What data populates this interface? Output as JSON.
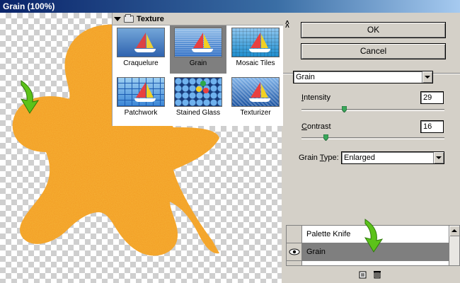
{
  "window": {
    "title": "Grain (100%)"
  },
  "gallery": {
    "folder_label": "Texture",
    "filters": [
      {
        "label": "Craquelure",
        "style": "crack",
        "selected": false
      },
      {
        "label": "Grain",
        "style": "grain",
        "selected": true
      },
      {
        "label": "Mosaic Tiles",
        "style": "mosaic",
        "selected": false
      },
      {
        "label": "Patchwork",
        "style": "patch",
        "selected": false
      },
      {
        "label": "Stained Glass",
        "style": "glass",
        "selected": false
      },
      {
        "label": "Texturizer",
        "style": "textur",
        "selected": false
      }
    ]
  },
  "buttons": {
    "ok": "OK",
    "cancel": "Cancel"
  },
  "filter_select": {
    "value": "Grain"
  },
  "settings": {
    "intensity": {
      "label_mnemonic": "I",
      "label_rest": "ntensity",
      "value": "29",
      "slider_fraction": 0.29
    },
    "contrast": {
      "label_mnemonic": "C",
      "label_rest": "ontrast",
      "value": "16",
      "slider_fraction": 0.16
    },
    "grain_type": {
      "label_before": "Grain ",
      "label_mnemonic": "T",
      "label_rest": "ype:",
      "value": "Enlarged"
    }
  },
  "layers": [
    {
      "name": "Palette Knife",
      "visible": false,
      "active": false
    },
    {
      "name": "Grain",
      "visible": true,
      "active": true
    }
  ],
  "colors": {
    "shape_fill": "#f29a28",
    "arrow_green": "#5cc21a",
    "selection_gray": "#7f7f7f",
    "dialog_face": "#d4d0c8"
  },
  "icons": {
    "new_effect_layer": "new-layer-icon",
    "delete_effect_layer": "trash-icon"
  }
}
